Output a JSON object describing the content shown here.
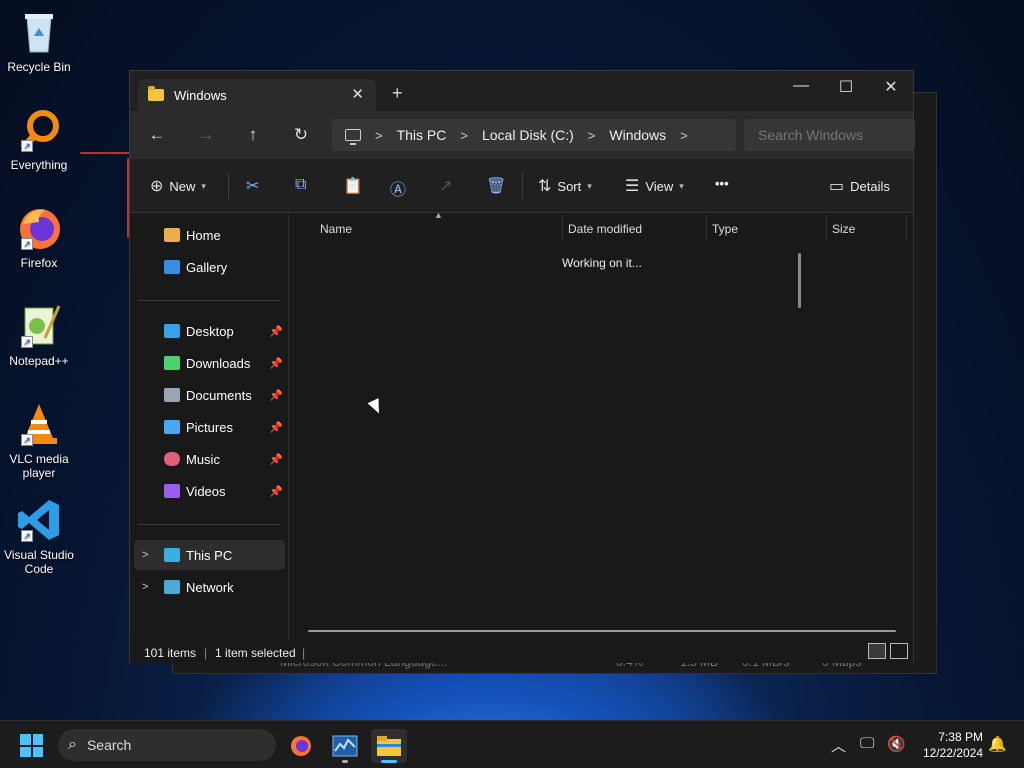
{
  "desktop": {
    "icons": [
      {
        "label": "Recycle Bin",
        "icon": "recycle-bin-icon"
      },
      {
        "label": "Everything",
        "icon": "everything-search-icon"
      },
      {
        "label": "Firefox",
        "icon": "firefox-icon"
      },
      {
        "label": "Notepad++",
        "icon": "notepad-plus-plus-icon"
      },
      {
        "label": "VLC media player",
        "icon": "vlc-icon"
      },
      {
        "label": "Visual Studio Code",
        "icon": "vscode-icon"
      }
    ]
  },
  "background_window": {
    "row": {
      "name": "Microsoft Common Language...",
      "cpu": "0.4%",
      "mem": "1.5 MB",
      "disk": "0.1 MB/s",
      "net": "0 Mbps"
    }
  },
  "explorer": {
    "tab": {
      "title": "Windows",
      "close": "✕"
    },
    "new_tab": "+",
    "window_controls": {
      "minimize": "—",
      "maximize": "☐",
      "close": "✕"
    },
    "nav": {
      "back": "←",
      "forward": "→",
      "up": "↑",
      "refresh": "↻"
    },
    "breadcrumb": [
      "This PC",
      "Local Disk (C:)",
      "Windows"
    ],
    "search_placeholder": "Search Windows",
    "toolbar": {
      "new_label": "New",
      "sort_label": "Sort",
      "view_label": "View",
      "more_label": "•••",
      "details_label": "Details"
    },
    "sidebar": {
      "home": "Home",
      "gallery": "Gallery",
      "quick_access": [
        {
          "label": "Desktop",
          "color": "#3aa0e8"
        },
        {
          "label": "Downloads",
          "color": "#4cd070"
        },
        {
          "label": "Documents",
          "color": "#9aa5b5"
        },
        {
          "label": "Pictures",
          "color": "#4aa8f0"
        },
        {
          "label": "Music",
          "color": "#e0607a"
        },
        {
          "label": "Videos",
          "color": "#9a5ef0"
        }
      ],
      "this_pc": "This PC",
      "network": "Network"
    },
    "columns": [
      "Name",
      "Date modified",
      "Type",
      "Size"
    ],
    "status_message": "Working on it...",
    "statusbar": {
      "items": "101 items",
      "selected": "1 item selected"
    }
  },
  "taskbar": {
    "search_label": "Search",
    "apps": [
      "firefox-icon",
      "task-manager-icon",
      "file-explorer-icon"
    ],
    "time": "7:38 PM",
    "date": "12/22/2024"
  },
  "colors": {
    "accent": "#4cc2ff",
    "folder": "#f4c441"
  }
}
